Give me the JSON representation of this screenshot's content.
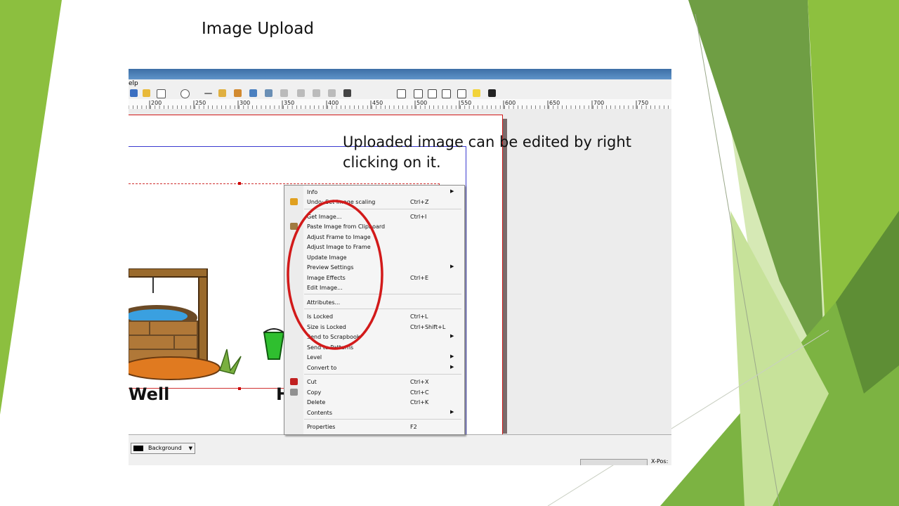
{
  "slide": {
    "title": "Image Upload",
    "callout": "Uploaded image can be edited by right clicking on it."
  },
  "app": {
    "menubar_fragment": "elp",
    "ruler_ticks": [
      "200",
      "250",
      "300",
      "350",
      "400",
      "450",
      "500",
      "550",
      "600",
      "650",
      "700",
      "750"
    ],
    "canvas_labels": {
      "well": "Well",
      "partial": "H"
    },
    "layer": "Background",
    "xpos_label": "X-Pos:"
  },
  "context_menu": {
    "items": [
      {
        "label": "Info",
        "shortcut": "",
        "submenu": true,
        "icon": ""
      },
      {
        "label": "Undo: Set image scaling",
        "shortcut": "Ctrl+Z",
        "submenu": false,
        "icon": "undo-icon"
      },
      {
        "label": "Get Image...",
        "shortcut": "Ctrl+I",
        "submenu": false,
        "icon": ""
      },
      {
        "label": "Paste Image from Clipboard",
        "shortcut": "",
        "submenu": false,
        "icon": "clipboard-icon"
      },
      {
        "label": "Adjust Frame to Image",
        "shortcut": "",
        "submenu": false,
        "icon": ""
      },
      {
        "label": "Adjust Image to Frame",
        "shortcut": "",
        "submenu": false,
        "icon": ""
      },
      {
        "label": "Update Image",
        "shortcut": "",
        "submenu": false,
        "icon": ""
      },
      {
        "label": "Preview Settings",
        "shortcut": "",
        "submenu": true,
        "icon": ""
      },
      {
        "label": "Image Effects",
        "shortcut": "Ctrl+E",
        "submenu": false,
        "icon": ""
      },
      {
        "label": "Edit Image...",
        "shortcut": "",
        "submenu": false,
        "icon": ""
      },
      {
        "label": "Attributes...",
        "shortcut": "",
        "submenu": false,
        "icon": ""
      },
      {
        "label": "Is Locked",
        "shortcut": "Ctrl+L",
        "submenu": false,
        "icon": ""
      },
      {
        "label": "Size is Locked",
        "shortcut": "Ctrl+Shift+L",
        "submenu": false,
        "icon": ""
      },
      {
        "label": "Send to Scrapbook",
        "shortcut": "",
        "submenu": true,
        "icon": ""
      },
      {
        "label": "Send to Patterns",
        "shortcut": "",
        "submenu": false,
        "icon": ""
      },
      {
        "label": "Level",
        "shortcut": "",
        "submenu": true,
        "icon": ""
      },
      {
        "label": "Convert to",
        "shortcut": "",
        "submenu": true,
        "icon": ""
      },
      {
        "label": "Cut",
        "shortcut": "Ctrl+X",
        "submenu": false,
        "icon": "scissors-icon"
      },
      {
        "label": "Copy",
        "shortcut": "Ctrl+C",
        "submenu": false,
        "icon": "copy-icon"
      },
      {
        "label": "Delete",
        "shortcut": "Ctrl+K",
        "submenu": false,
        "icon": ""
      },
      {
        "label": "Contents",
        "shortcut": "",
        "submenu": true,
        "icon": ""
      },
      {
        "label": "Properties",
        "shortcut": "F2",
        "submenu": false,
        "icon": ""
      }
    ]
  },
  "colors": {
    "green_dark": "#6b9a3c",
    "green_mid": "#8cbf3f",
    "green_light": "#b5d97a",
    "annotation_red": "#d21a1a"
  }
}
